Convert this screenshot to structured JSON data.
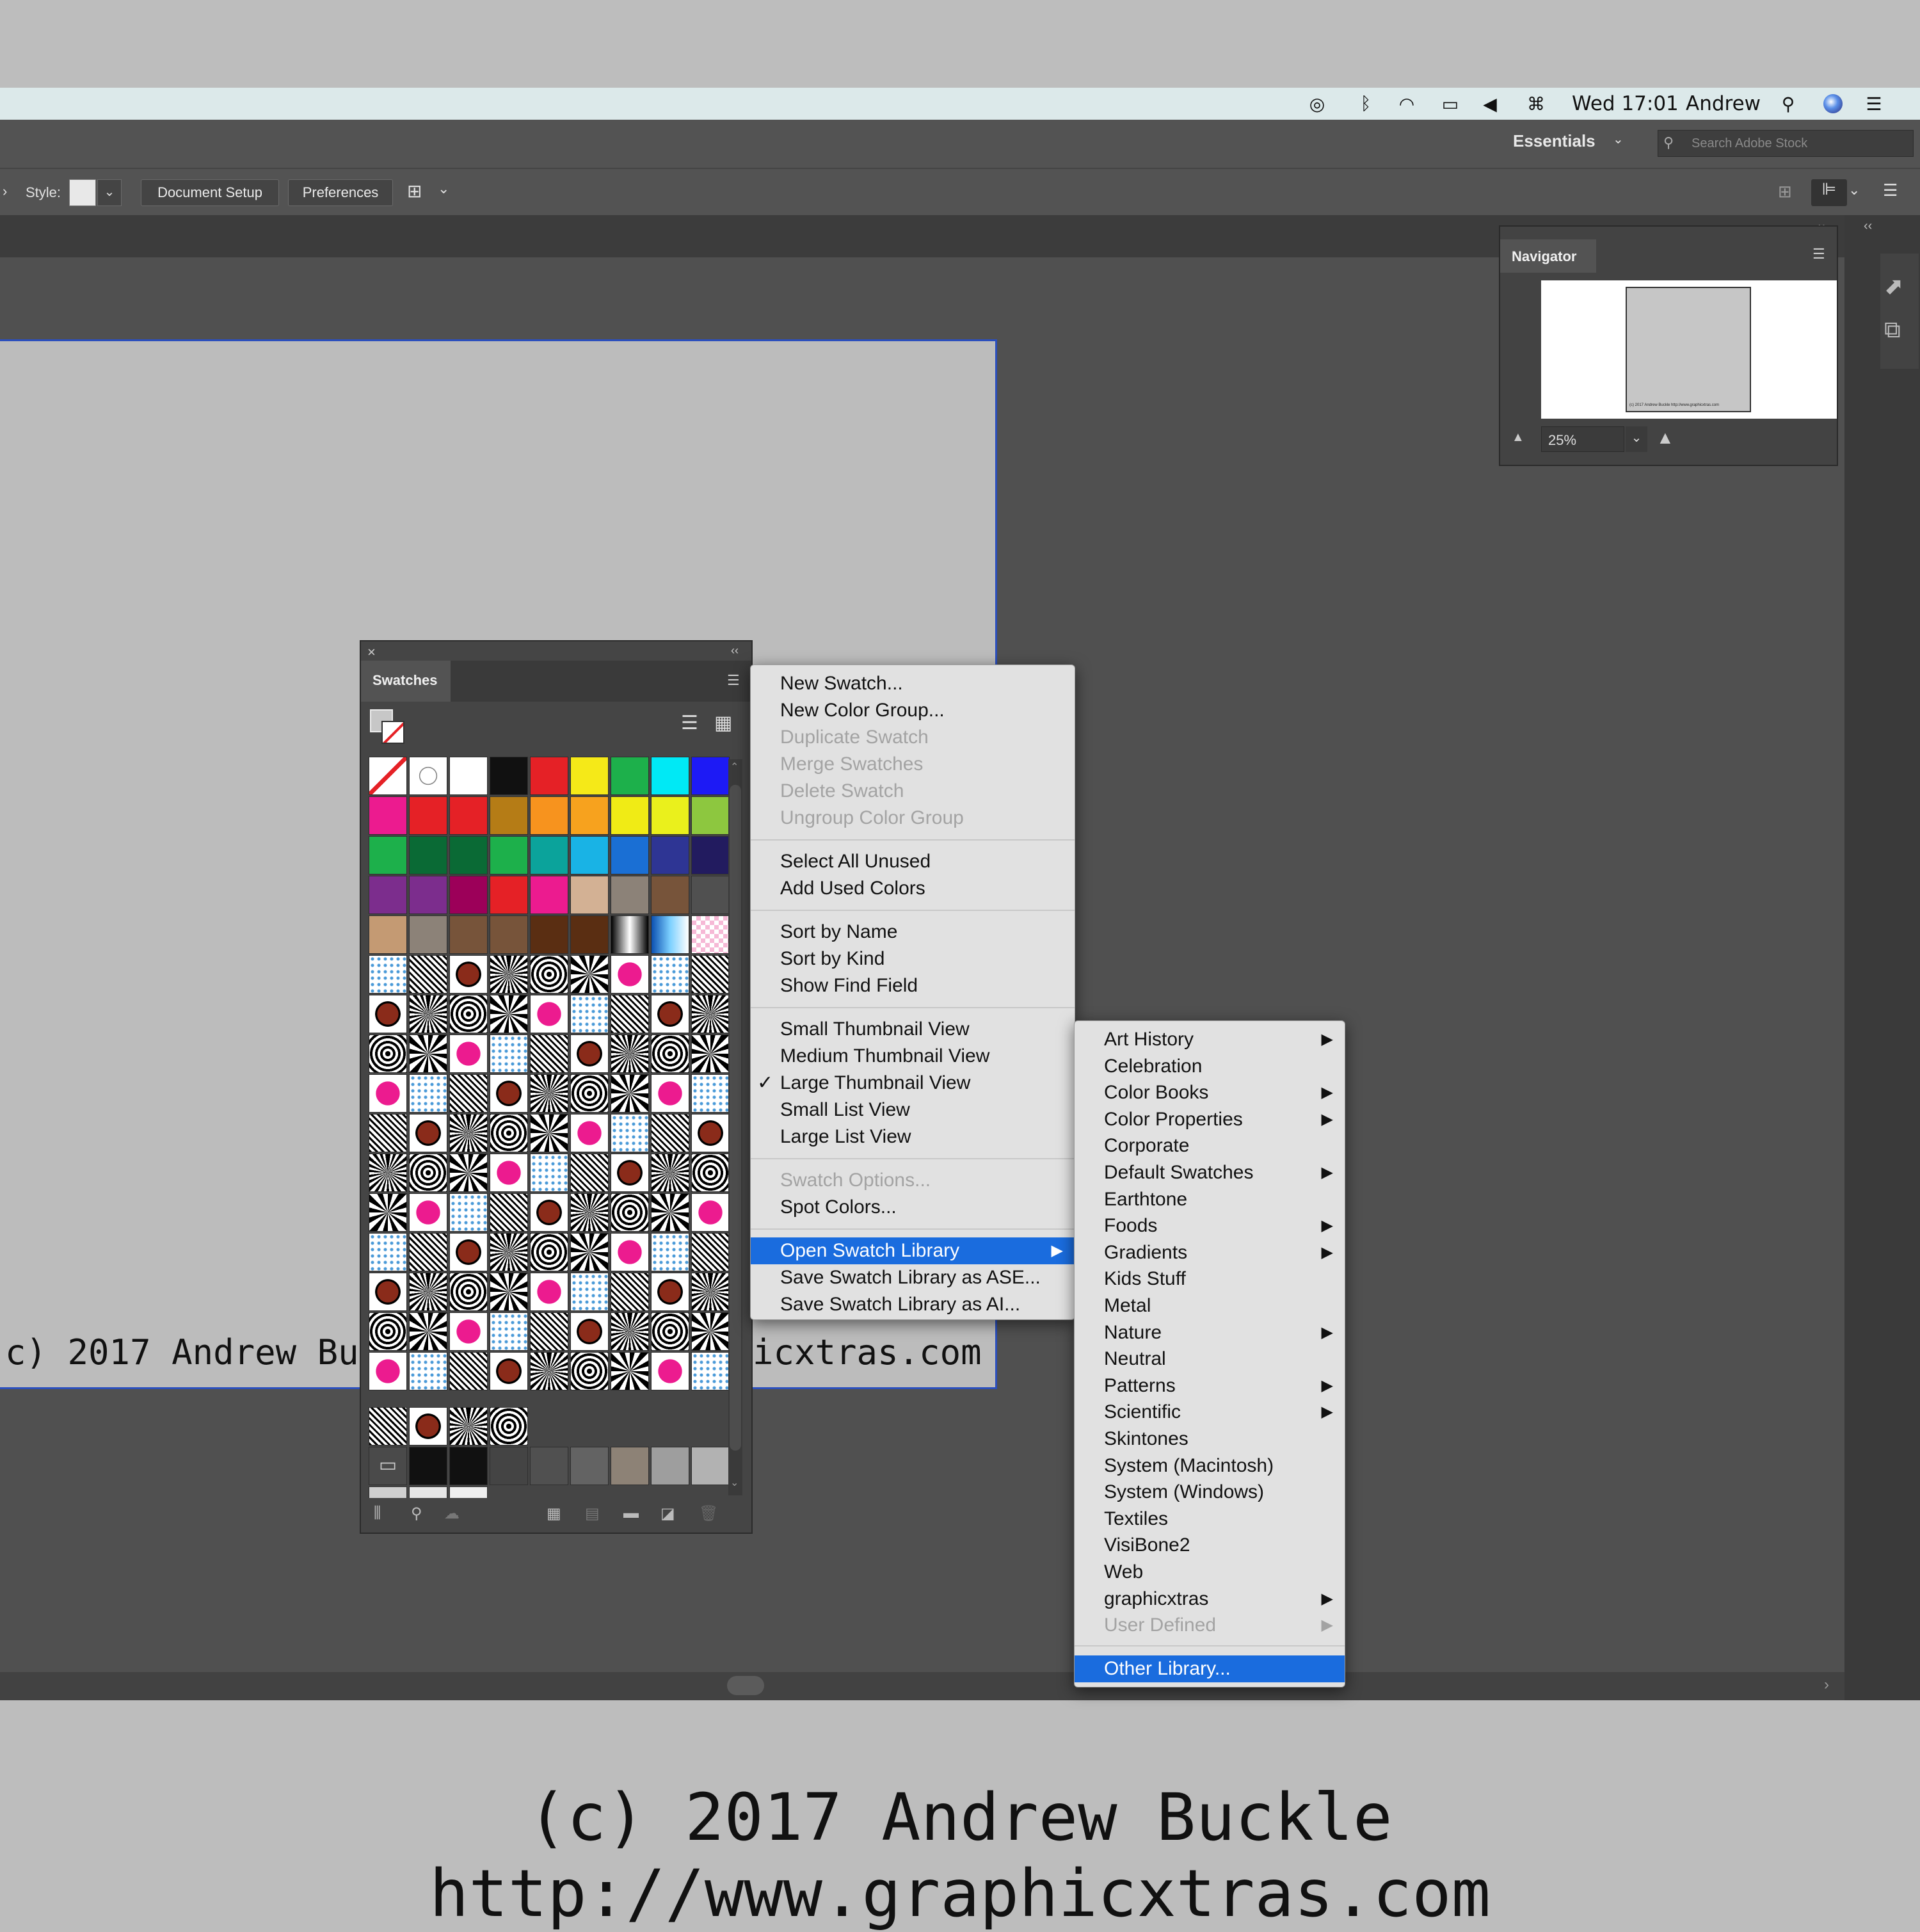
{
  "menubar": {
    "clock": "Wed 17:01",
    "user": "Andrew"
  },
  "header": {
    "workspace": "Essentials",
    "search_placeholder": "Search Adobe Stock"
  },
  "controlbar": {
    "style_label": "Style:",
    "doc_setup": "Document Setup",
    "preferences": "Preferences"
  },
  "navigator": {
    "title": "Navigator",
    "zoom": "25%",
    "thumb_text": "(c) 2017 Andrew Buckle http://www.graphicxtras.com"
  },
  "artboard": {
    "text_left": "c) 2017 Andrew Buc",
    "text_right": "icxtras.com"
  },
  "swatches": {
    "title": "Swatches"
  },
  "context_menu": {
    "items": [
      {
        "label": "New Swatch..."
      },
      {
        "label": "New Color Group..."
      },
      {
        "label": "Duplicate Swatch"
      },
      {
        "label": "Merge Swatches"
      },
      {
        "label": "Delete Swatch"
      },
      {
        "label": "Ungroup Color Group"
      },
      {
        "label": "Select All Unused"
      },
      {
        "label": "Add Used Colors"
      },
      {
        "label": "Sort by Name"
      },
      {
        "label": "Sort by Kind"
      },
      {
        "label": "Show Find Field"
      },
      {
        "label": "Small Thumbnail View"
      },
      {
        "label": "Medium Thumbnail View"
      },
      {
        "label": "Large Thumbnail View"
      },
      {
        "label": "Small List View"
      },
      {
        "label": "Large List View"
      },
      {
        "label": "Swatch Options..."
      },
      {
        "label": "Spot Colors..."
      },
      {
        "label": "Open Swatch Library"
      },
      {
        "label": "Save Swatch Library as ASE..."
      },
      {
        "label": "Save Swatch Library as AI..."
      }
    ]
  },
  "library_menu": {
    "items": [
      {
        "label": "Art History"
      },
      {
        "label": "Celebration"
      },
      {
        "label": "Color Books"
      },
      {
        "label": "Color Properties"
      },
      {
        "label": "Corporate"
      },
      {
        "label": "Default Swatches"
      },
      {
        "label": "Earthtone"
      },
      {
        "label": "Foods"
      },
      {
        "label": "Gradients"
      },
      {
        "label": "Kids Stuff"
      },
      {
        "label": "Metal"
      },
      {
        "label": "Nature"
      },
      {
        "label": "Neutral"
      },
      {
        "label": "Patterns"
      },
      {
        "label": "Scientific"
      },
      {
        "label": "Skintones"
      },
      {
        "label": "System (Macintosh)"
      },
      {
        "label": "System (Windows)"
      },
      {
        "label": "Textiles"
      },
      {
        "label": "VisiBone2"
      },
      {
        "label": "Web"
      },
      {
        "label": "graphicxtras"
      },
      {
        "label": "User Defined"
      },
      {
        "label": "Other Library..."
      }
    ]
  },
  "swatch_colors": [
    [
      "none",
      "reg",
      "#ffffff",
      "#111111",
      "#e52126",
      "#f5e918",
      "#1db04b",
      "#00e9f5",
      "#1d1af5"
    ],
    [
      "#ec1b8f",
      "#e52126",
      "#e52126",
      "#b57c16",
      "#f7931e",
      "#f7a21e",
      "#f0eb15",
      "#eaf01c",
      "#8dc73f"
    ],
    [
      "#1db04b",
      "#0a6a35",
      "#0a6a35",
      "#1db04b",
      "#0ba39b",
      "#19b3e5",
      "#1a6fd4",
      "#2e3594",
      "#221b5f"
    ],
    [
      "#7c2d8d",
      "#7c2d8d",
      "#9c0059",
      "#e52126",
      "#ec1b8f",
      "#d3b194",
      "#8c8278",
      "#77543a",
      "#505050"
    ],
    [
      "#c49a73",
      "#8c8278",
      "#77543a",
      "#77543a",
      "#5a2e12",
      "#5a2e12",
      "grad-bw",
      "grad-blue",
      "grad-pink"
    ],
    [
      "pat",
      "pat",
      "pat",
      "pat",
      "pat",
      "pat",
      "pat",
      "pat",
      "pat"
    ],
    [
      "pat",
      "pat",
      "pat",
      "pat",
      "pat",
      "pat",
      "pat",
      "pat",
      "pat"
    ],
    [
      "pat",
      "pat",
      "pat",
      "pat",
      "pat",
      "pat",
      "pat",
      "pat",
      "pat"
    ],
    [
      "pat",
      "pat",
      "pat",
      "pat",
      "pat",
      "pat",
      "pat",
      "pat",
      "pat"
    ],
    [
      "pat",
      "pat",
      "pat",
      "pat",
      "pat",
      "pat",
      "pat",
      "pat",
      "pat"
    ],
    [
      "pat",
      "pat",
      "pat",
      "pat",
      "pat",
      "pat",
      "pat",
      "pat",
      "pat"
    ],
    [
      "pat",
      "pat",
      "pat",
      "pat",
      "pat",
      "pat",
      "pat",
      "pat",
      "pat"
    ],
    [
      "pat",
      "pat",
      "pat",
      "pat",
      "pat",
      "pat",
      "pat",
      "pat",
      "pat"
    ],
    [
      "pat",
      "pat",
      "pat",
      "pat",
      "pat",
      "pat",
      "pat",
      "pat",
      "pat"
    ],
    [
      "pat",
      "pat",
      "pat",
      "pat",
      "pat",
      "pat",
      "pat",
      "pat",
      "pat"
    ],
    [
      "pat",
      "pat",
      "pat",
      "pat",
      "pat",
      "pat",
      "pat",
      "pat",
      "pat"
    ],
    [
      "pat",
      "pat",
      "pat",
      "pat"
    ]
  ],
  "caption": "(c) 2017 Andrew Buckle http://www.graphicxtras.com"
}
